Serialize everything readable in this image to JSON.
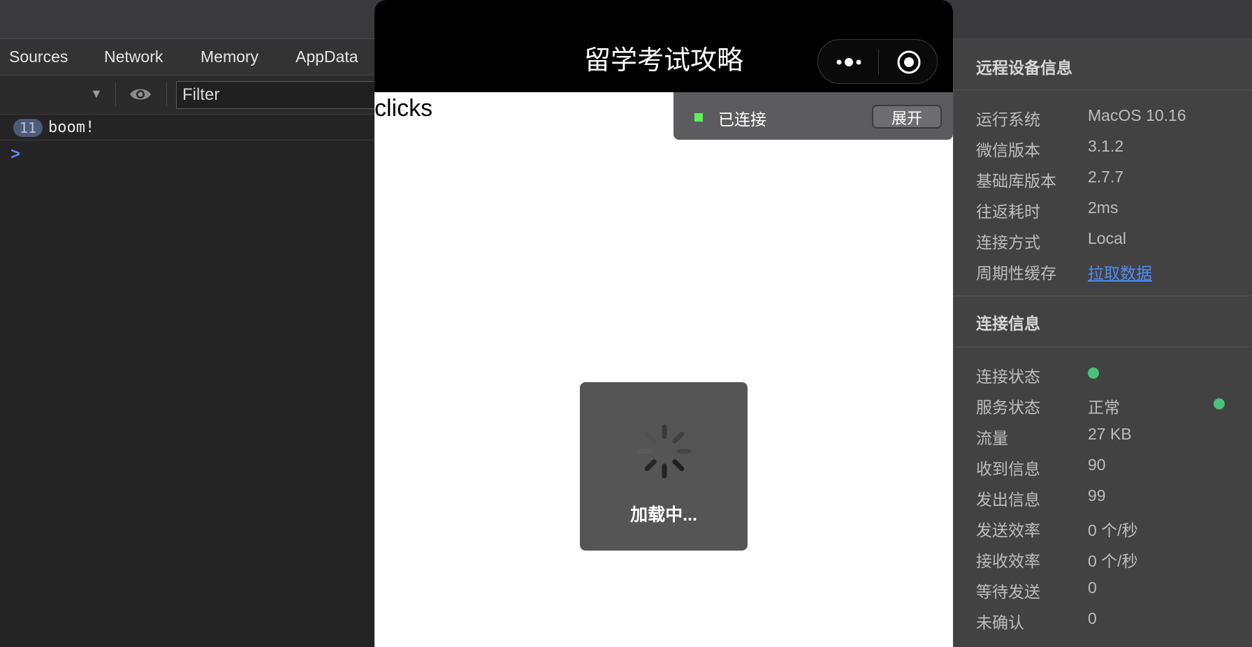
{
  "devtools": {
    "tabs": [
      "Sources",
      "Network",
      "Memory",
      "AppData"
    ],
    "filter_placeholder": "Filter",
    "log": {
      "count": "11",
      "message": "boom!"
    },
    "prompt": ">"
  },
  "simulator": {
    "title": "留学考试攻略",
    "body_text": "clicks",
    "connection": {
      "status_label": "已连接",
      "expand_label": "展开"
    },
    "toast_text": "加载中..."
  },
  "panel": {
    "device_title": "远程设备信息",
    "device_rows": [
      {
        "label": "运行系统",
        "value": "MacOS 10.16"
      },
      {
        "label": "微信版本",
        "value": "3.1.2"
      },
      {
        "label": "基础库版本",
        "value": "2.7.7"
      },
      {
        "label": "往返耗时",
        "value": "2ms"
      },
      {
        "label": "连接方式",
        "value": "Local"
      },
      {
        "label": "周期性缓存",
        "value": "拉取数据"
      }
    ],
    "conn_title": "连接信息",
    "conn_rows": [
      {
        "label": "连接状态",
        "value": ""
      },
      {
        "label": "服务状态",
        "value": "正常"
      },
      {
        "label": "流量",
        "value": "27 KB"
      },
      {
        "label": "收到信息",
        "value": "90"
      },
      {
        "label": "发出信息",
        "value": "99"
      },
      {
        "label": "发送效率",
        "value": "0 个/秒"
      },
      {
        "label": "接收效率",
        "value": "0 个/秒"
      },
      {
        "label": "等待发送",
        "value": "0"
      },
      {
        "label": "未确认",
        "value": "0"
      }
    ],
    "status_color": "#48c27a",
    "link_color": "#4d8cf5"
  }
}
